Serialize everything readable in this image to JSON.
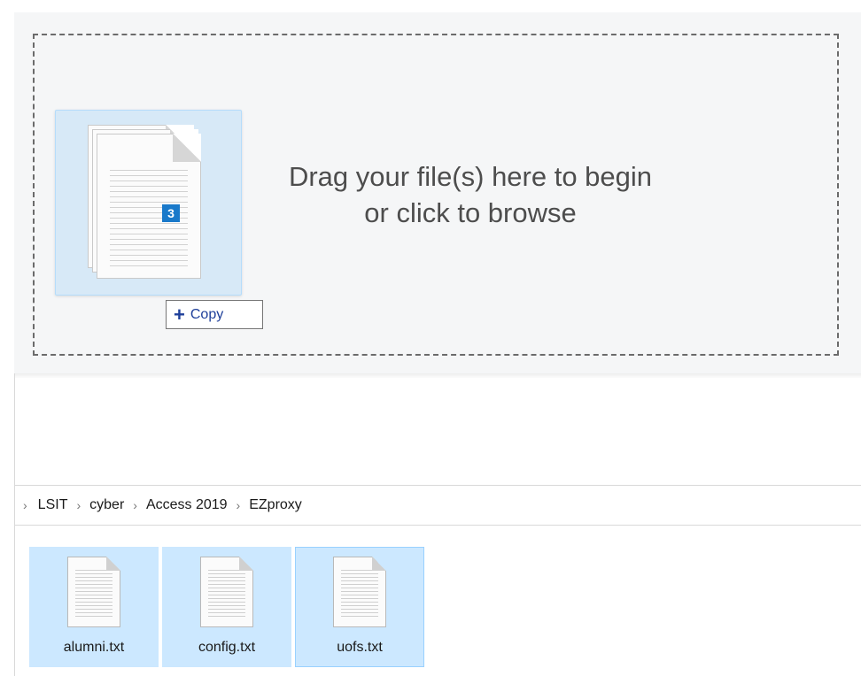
{
  "upload": {
    "line1": "Drag your file(s) here to begin",
    "line2": "or click to browse",
    "drag_count": "3",
    "copy_label": "Copy",
    "copy_symbol": "+"
  },
  "breadcrumb": {
    "items": [
      "LSIT",
      "cyber",
      "Access 2019",
      "EZproxy"
    ]
  },
  "files": [
    {
      "name": "alumni.txt",
      "icon": "text-file-icon"
    },
    {
      "name": "config.txt",
      "icon": "text-file-icon"
    },
    {
      "name": "uofs.txt",
      "icon": "text-file-icon"
    }
  ],
  "colors": {
    "selection": "#cce8ff",
    "selection_border": "#99d1ff",
    "badge": "#1979ca",
    "copy_text": "#1e3f9a"
  }
}
